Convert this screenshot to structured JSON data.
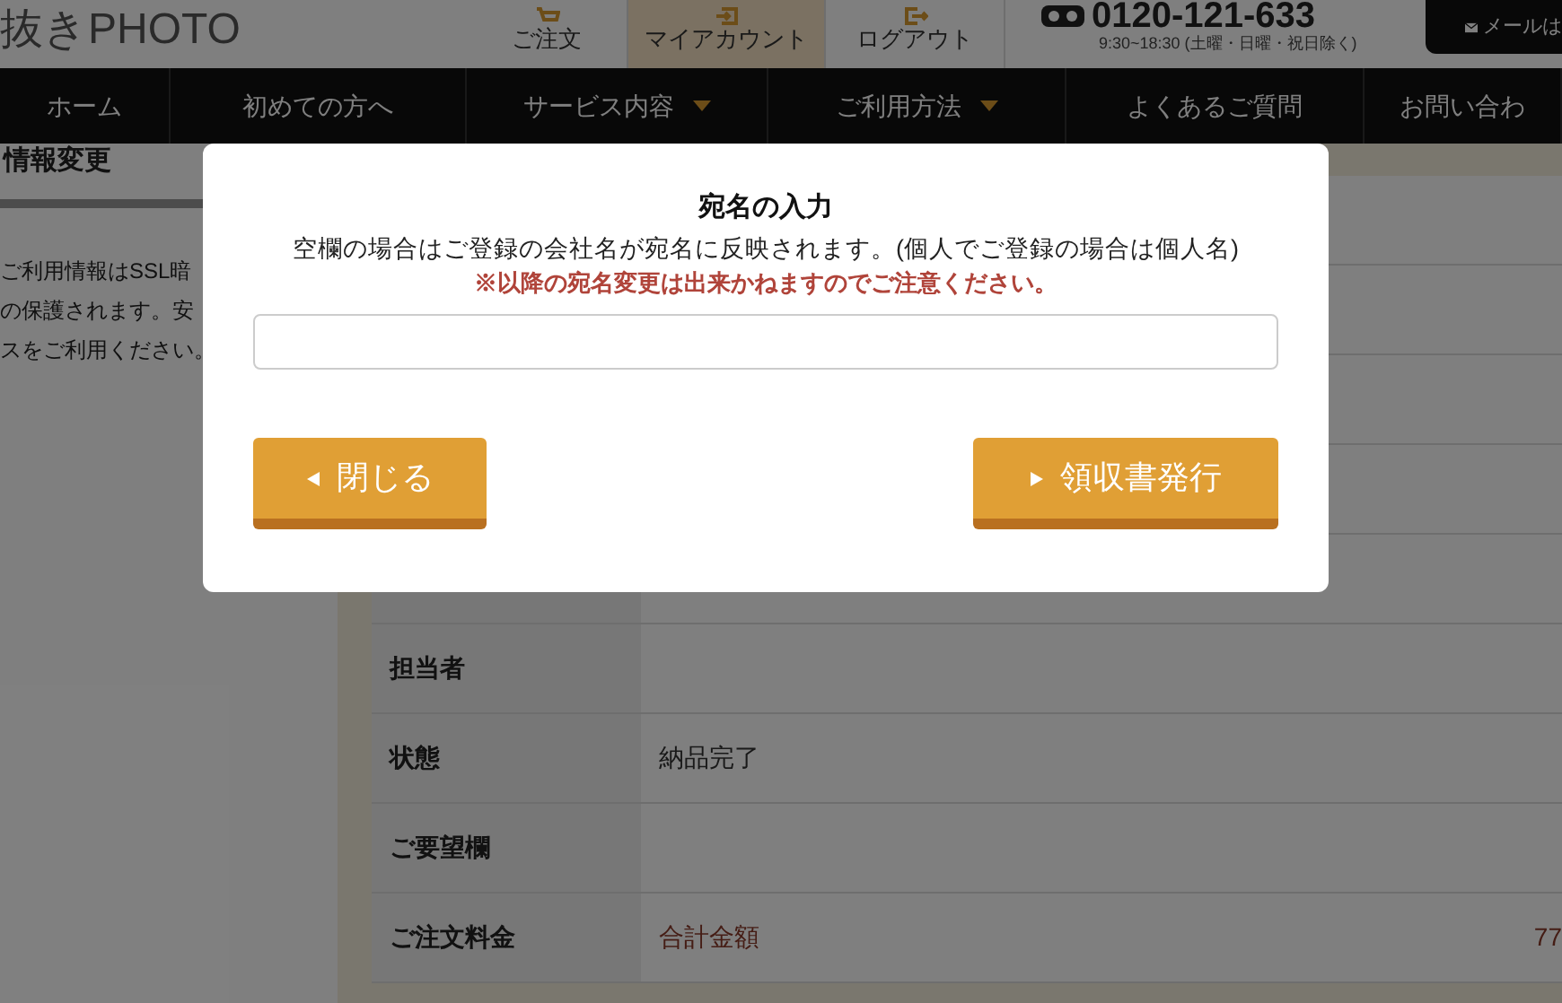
{
  "header": {
    "logo": "抜きPHOTO",
    "links": [
      {
        "label": "ご注文",
        "selected": false
      },
      {
        "label": "マイアカウント",
        "selected": true
      },
      {
        "label": "ログアウト",
        "selected": false
      }
    ],
    "phone": "0120-121-633",
    "hours": "9:30~18:30 (土曜・日曜・祝日除く)",
    "mail_button": "メールは"
  },
  "nav": [
    {
      "label": "ホーム",
      "dropdown": false
    },
    {
      "label": "初めての方へ",
      "dropdown": false
    },
    {
      "label": "サービス内容",
      "dropdown": true
    },
    {
      "label": "ご利用方法",
      "dropdown": true
    },
    {
      "label": "よくあるご質問",
      "dropdown": false
    },
    {
      "label": "お問い合わ",
      "dropdown": false
    }
  ],
  "sidebar": {
    "title": "情報変更",
    "lines": [
      "ご利用情報はSSL暗",
      "の保護されます。安",
      "スをご利用ください。"
    ]
  },
  "table": {
    "rows": [
      {
        "label": "",
        "value": ""
      },
      {
        "label": "",
        "value": ""
      },
      {
        "label": "",
        "value": ""
      },
      {
        "label": "",
        "value": ""
      },
      {
        "label": "",
        "value": ""
      },
      {
        "label": "担当者",
        "value": ""
      },
      {
        "label": "状態",
        "value": "納品完了"
      },
      {
        "label": "ご要望欄",
        "value": ""
      },
      {
        "label": "ご注文料金",
        "value": "合計金額",
        "amount": "77",
        "kind": "total"
      }
    ]
  },
  "modal": {
    "title": "宛名の入力",
    "description": "空欄の場合はご登録の会社名が宛名に反映されます。(個人でご登録の場合は個人名)",
    "warning": "※以降の宛名変更は出来かねますのでご注意ください。",
    "buttons": [
      {
        "label": "閉じる",
        "kind": "back"
      },
      {
        "label": "領収書発行",
        "kind": "forward"
      }
    ]
  }
}
